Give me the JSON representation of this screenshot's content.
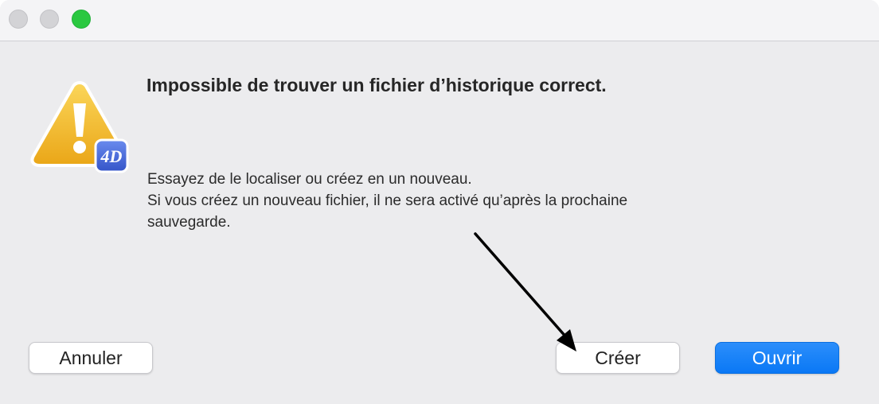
{
  "window": {
    "traffic_lights": [
      "close",
      "minimize",
      "zoom"
    ],
    "colors": {
      "zoom": "#2ac840",
      "inactive": "#d3d3d6"
    }
  },
  "dialog": {
    "icon": "warning-triangle-icon",
    "badge_text": "4D",
    "title": "Impossible de trouver un fichier d’historique correct.",
    "message_lines": [
      "Essayez de le localiser ou créez en un nouveau.",
      "Si vous créez un nouveau fichier, il ne sera activé qu’après la prochaine",
      "sauvegarde."
    ]
  },
  "buttons": {
    "cancel": "Annuler",
    "create": "Créer",
    "open": "Ouvrir"
  },
  "annotation": {
    "type": "arrow",
    "points_to": "create-button",
    "color": "#000000"
  },
  "colors": {
    "primary": "#0a78f5",
    "warning": "#f3b622"
  }
}
